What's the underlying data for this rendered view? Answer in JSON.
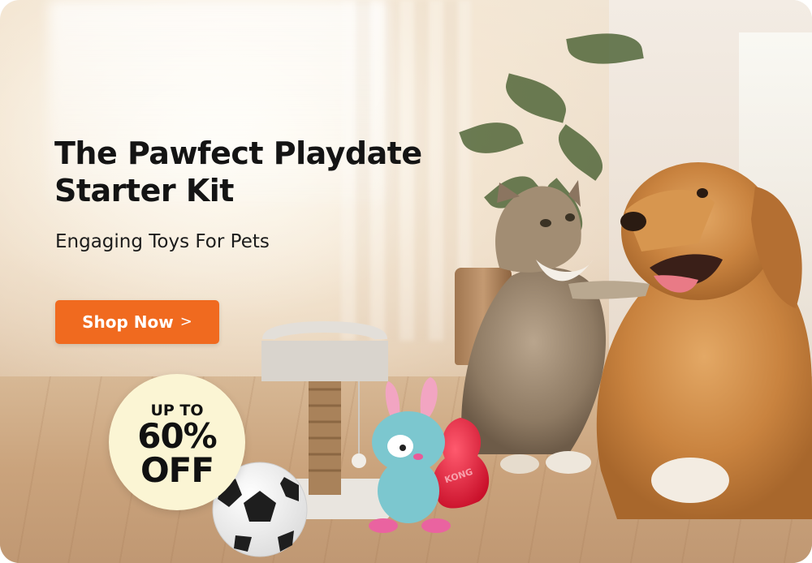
{
  "banner": {
    "headline": "The Pawfect Playdate Starter Kit",
    "subhead": "Engaging Toys For Pets",
    "cta_label": "Shop Now",
    "cta_chevron": ">",
    "badge": {
      "line1": "UP TO",
      "line2": "60%",
      "line3": "OFF"
    },
    "toy_brand_text": "KONG"
  },
  "colors": {
    "cta": "#f06a1f",
    "badge_bg": "#fbf5d4",
    "headline": "#141414"
  },
  "icons": [
    "chevron-right-icon"
  ]
}
